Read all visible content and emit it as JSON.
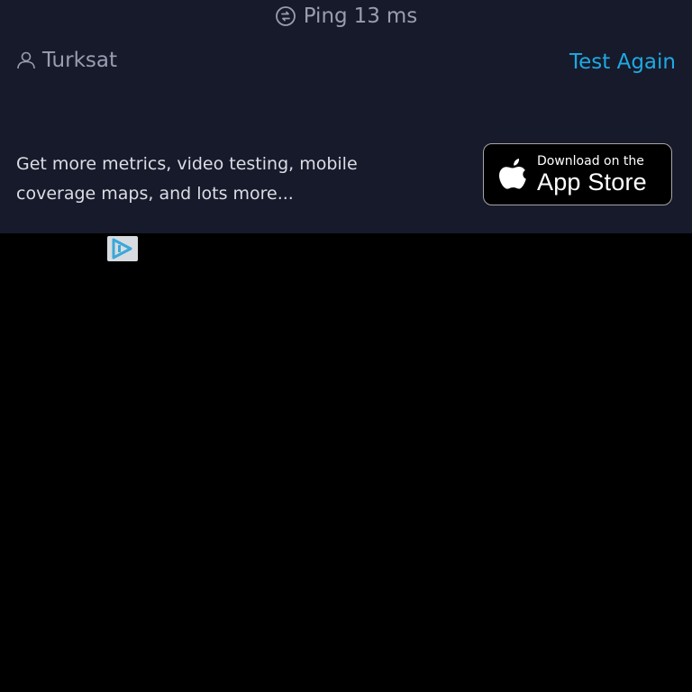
{
  "ping": {
    "label": "Ping",
    "value": "13",
    "unit": "ms"
  },
  "provider": {
    "name": "Turksat"
  },
  "actions": {
    "test_again": "Test Again"
  },
  "promo": {
    "line1": "Get more metrics, video testing, mobile",
    "line2": "coverage maps, and lots more..."
  },
  "appstore": {
    "top_line": "Download on the",
    "bottom_line": "App Store"
  },
  "icons": {
    "ping": "ping-icon",
    "provider": "person-icon",
    "appstore": "apple-icon",
    "ad": "ad-choices-icon"
  },
  "colors": {
    "panel_bg": "#171a2b",
    "accent": "#1fa9e1",
    "muted_text": "#9a9db0",
    "page_bg": "#000000"
  }
}
